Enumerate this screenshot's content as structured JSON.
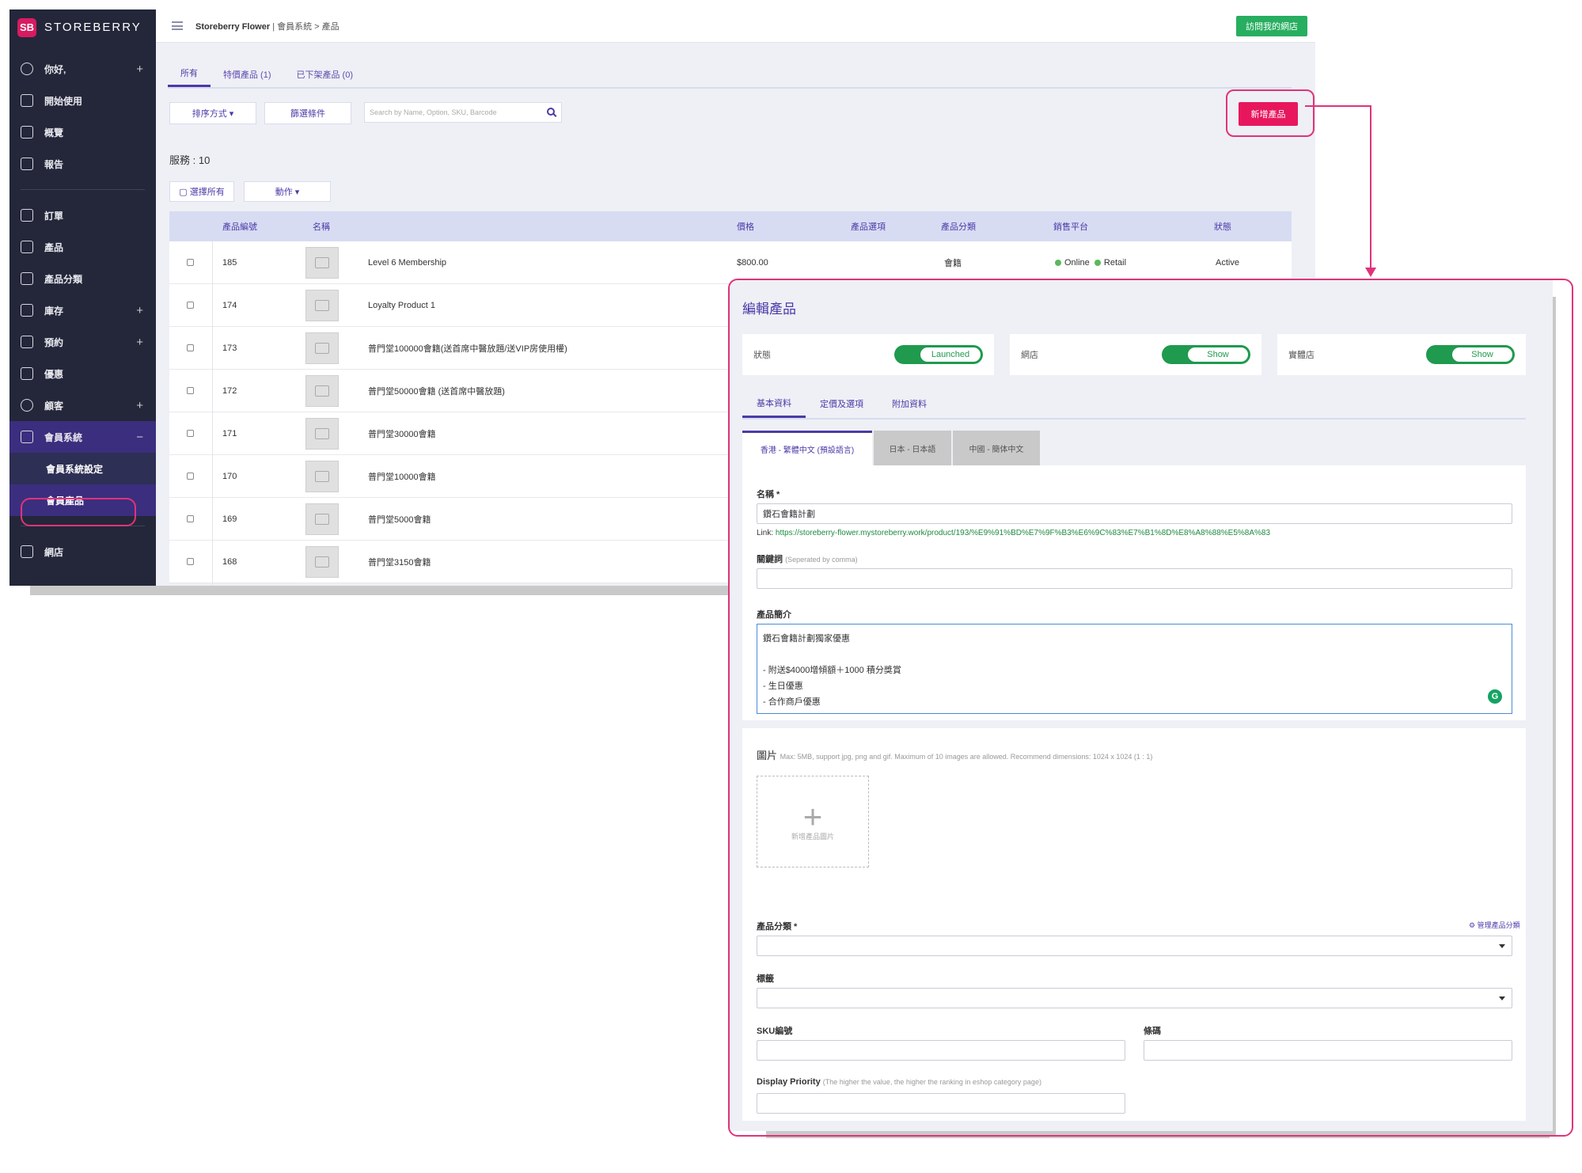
{
  "brand": {
    "logo_text": "SB",
    "name": "STOREBERRY"
  },
  "sidebar": {
    "items": [
      {
        "label": "你好,",
        "icon": "user-icon",
        "expandable": true
      },
      {
        "label": "開始使用",
        "icon": "flag-icon"
      },
      {
        "label": "概覽",
        "icon": "chart-icon"
      },
      {
        "label": "報告",
        "icon": "document-icon"
      },
      {
        "label": "訂單",
        "icon": "cart-icon"
      },
      {
        "label": "產品",
        "icon": "box-icon"
      },
      {
        "label": "產品分類",
        "icon": "list-icon"
      },
      {
        "label": "庫存",
        "icon": "inventory-icon",
        "expandable": true
      },
      {
        "label": "預約",
        "icon": "calendar-icon",
        "expandable": true
      },
      {
        "label": "優惠",
        "icon": "ticket-icon"
      },
      {
        "label": "顧客",
        "icon": "customer-icon",
        "expandable": true
      },
      {
        "label": "會員系統",
        "icon": "member-icon",
        "collapse_symbol": "−"
      }
    ],
    "member_sub": [
      "會員系統設定",
      "會員產品"
    ],
    "bottom": {
      "label": "網店",
      "icon": "shop-icon"
    }
  },
  "topbar": {
    "store": "Storeberry Flower",
    "path": "| 會員系統 > 產品",
    "visit_button": "訪問我的網店"
  },
  "tabs": [
    "所有",
    "特價產品 (1)",
    "已下架產品 (0)"
  ],
  "toolbar": {
    "sort": "排序方式 ▾",
    "filter": "篩選條件",
    "search_placeholder": "Search by Name, Option, SKU, Barcode",
    "add_button": "新增產品",
    "count": "服務 : 10",
    "select_all": "▢ 選擇所有",
    "actions": "動作 ▾"
  },
  "table": {
    "headers": [
      "產品編號",
      "名稱",
      "價格",
      "產品選項",
      "產品分類",
      "銷售平台",
      "狀態"
    ],
    "rows": [
      {
        "id": "185",
        "name": "Level 6 Membership",
        "price": "$800.00",
        "category": "會籍",
        "platform_online": "Online",
        "platform_retail": "Retail",
        "status": "Active"
      },
      {
        "id": "174",
        "name": "Loyalty Product 1"
      },
      {
        "id": "173",
        "name": "普門堂100000會籍(送首席中醫放題/送VIP房使用權)"
      },
      {
        "id": "172",
        "name": "普門堂50000會籍 (送首席中醫放題)"
      },
      {
        "id": "171",
        "name": "普門堂30000會籍"
      },
      {
        "id": "170",
        "name": "普門堂10000會籍"
      },
      {
        "id": "169",
        "name": "普門堂5000會籍"
      },
      {
        "id": "168",
        "name": "普門堂3150會籍"
      }
    ]
  },
  "edit": {
    "title": "編輯產品",
    "toggles": [
      {
        "label": "狀態",
        "value": "Launched"
      },
      {
        "label": "網店",
        "value": "Show"
      },
      {
        "label": "實體店",
        "value": "Show"
      }
    ],
    "sub_tabs": [
      "基本資料",
      "定價及選項",
      "附加資料"
    ],
    "lang_tabs": [
      "香港 - 繁體中文 (預設語言)",
      "日本 - 日本語",
      "中國 - 簡体中文"
    ],
    "name_label": "名稱 *",
    "name_value": "鑽石會籍計劃",
    "link_prefix": "Link:",
    "link_url": "https://storeberry-flower.mystoreberry.work/product/193/%E9%91%BD%E7%9F%B3%E6%9C%83%E7%B1%8D%E8%A8%88%E5%8A%83",
    "keywords_label": "關鍵詞",
    "keywords_hint": "(Seperated by comma)",
    "desc_label": "產品簡介",
    "desc_value": "鑽石會籍計劃獨家優惠\n\n- 附送$4000增傾額＋1000 積分獎賞\n- 生日優惠\n- 合作商戶優惠",
    "grammarly": "G",
    "image_label": "圖片",
    "image_hint": "Max: 5MB, support jpg, png and gif. Maximum of 10 images are allowed. Recommend dimensions: 1024 x 1024 (1 : 1)",
    "upload_label": "新增產品圖片",
    "category_label": "產品分類 *",
    "manage_category": "⚙ 管理產品分類",
    "tag_label": "標籤",
    "sku_label": "SKU編號",
    "barcode_label": "條碼",
    "priority_label": "Display Priority",
    "priority_hint": "(The higher the value, the higher the ranking in eshop category page)"
  }
}
